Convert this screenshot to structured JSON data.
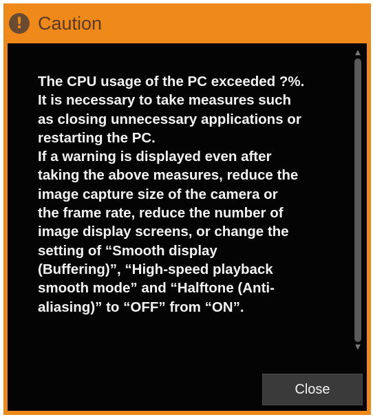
{
  "dialog": {
    "title": "Caution",
    "icon": "exclamation-icon",
    "message": "The CPU usage of the PC exceeded ?%.\nIt is necessary to take measures such\nas closing unnecessary applications or\nrestarting the PC.\nIf a warning is displayed even after\ntaking the above measures, reduce the\nimage capture size of the camera or\nthe frame rate, reduce the number of\nimage display screens, or change the\nsetting of “Smooth display\n(Buffering)”, “High-speed playback\nsmooth mode” and “Halftone (Anti-\naliasing)” to “OFF” from “ON”.",
    "close_label": "Close"
  },
  "colors": {
    "accent": "#ef8a1a",
    "background": "#040404",
    "text": "#f2f2f2",
    "button": "#3a3a3a"
  }
}
